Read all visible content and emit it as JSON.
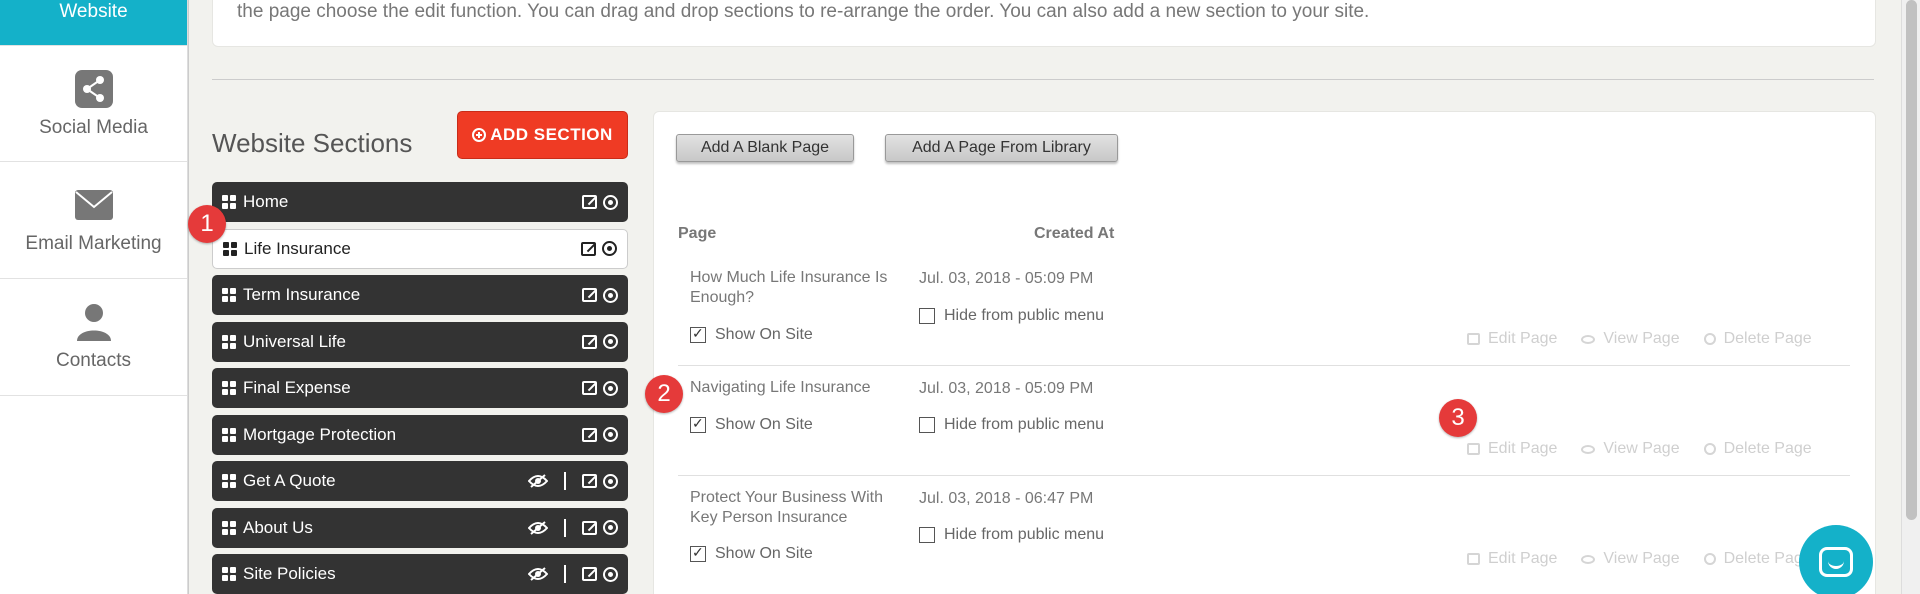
{
  "sidebar": {
    "items": [
      {
        "label": "Website",
        "icon": "website-icon",
        "active": true
      },
      {
        "label": "Social Media",
        "icon": "share-icon"
      },
      {
        "label": "Email Marketing",
        "icon": "envelope-icon"
      },
      {
        "label": "Contacts",
        "icon": "user-icon"
      }
    ]
  },
  "intro_text": "the page choose the edit function. You can drag and drop sections to re-arrange the order. You can also add a new section to your site.",
  "sections": {
    "title": "Website Sections",
    "add_label": "ADD SECTION",
    "items": [
      {
        "label": "Home"
      },
      {
        "label": "Life Insurance"
      },
      {
        "label": "Term Insurance"
      },
      {
        "label": "Universal Life"
      },
      {
        "label": "Final Expense"
      },
      {
        "label": "Mortgage Protection"
      },
      {
        "label": "Get A Quote"
      },
      {
        "label": "About Us"
      },
      {
        "label": "Site Policies"
      }
    ]
  },
  "pages": {
    "add_blank_label": "Add A Blank Page",
    "add_library_label": "Add A Page From Library",
    "col_page": "Page",
    "col_created": "Created At",
    "show_on_site": "Show On Site",
    "hide_menu": "Hide from public menu",
    "edit_page": "Edit Page",
    "view_page": "View Page",
    "delete_page": "Delete Page",
    "rows": [
      {
        "title": "How Much Life Insurance Is Enough?",
        "date": "Jul. 03, 2018 - 05:09 PM"
      },
      {
        "title": "Navigating Life Insurance",
        "date": "Jul. 03, 2018 - 05:09 PM"
      },
      {
        "title": "Protect Your Business With Key Person Insurance",
        "date": "Jul. 03, 2018 - 06:47 PM"
      }
    ]
  },
  "badges": [
    "1",
    "2",
    "3"
  ],
  "colors": {
    "accent": "#14b1c9",
    "danger": "#ef3b24",
    "badge": "#e53a3a",
    "section_dark": "#333333"
  }
}
